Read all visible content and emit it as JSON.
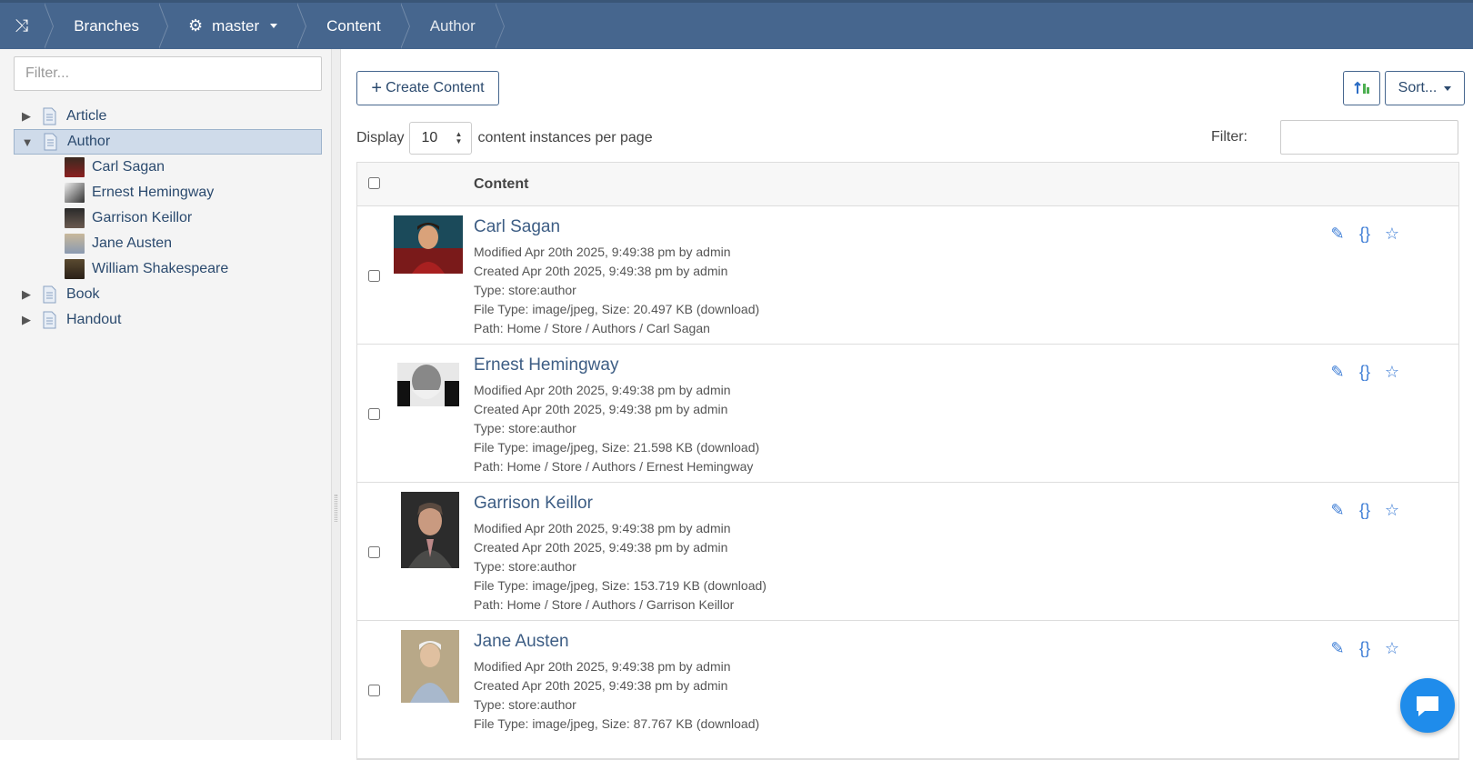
{
  "breadcrumb": {
    "items": [
      {
        "label": "Branches"
      },
      {
        "label": "master"
      },
      {
        "label": "Content"
      },
      {
        "label": "Author"
      }
    ]
  },
  "sidebar": {
    "filter_placeholder": "Filter...",
    "tree": [
      {
        "label": "Article",
        "expanded": false
      },
      {
        "label": "Author",
        "expanded": true,
        "selected": true,
        "children": [
          "Carl Sagan",
          "Ernest Hemingway",
          "Garrison Keillor",
          "Jane Austen",
          "William Shakespeare"
        ]
      },
      {
        "label": "Book",
        "expanded": false
      },
      {
        "label": "Handout",
        "expanded": false
      }
    ]
  },
  "toolbar": {
    "create_label": "Create Content",
    "sort_label": "Sort..."
  },
  "display": {
    "prefix": "Display",
    "per_page": "10",
    "suffix": "content instances per page",
    "filter_label": "Filter:"
  },
  "table": {
    "header": "Content",
    "rows": [
      {
        "title": "Carl Sagan",
        "modified": "Modified Apr 20th 2025, 9:49:38 pm by admin",
        "created": "Created Apr 20th 2025, 9:49:38 pm by admin",
        "type": "Type: store:author",
        "file": "File Type: image/jpeg, Size: 20.497 KB (download)",
        "path": "Path: Home / Store / Authors / Carl Sagan"
      },
      {
        "title": "Ernest Hemingway",
        "modified": "Modified Apr 20th 2025, 9:49:38 pm by admin",
        "created": "Created Apr 20th 2025, 9:49:38 pm by admin",
        "type": "Type: store:author",
        "file": "File Type: image/jpeg, Size: 21.598 KB (download)",
        "path": "Path: Home / Store / Authors / Ernest Hemingway"
      },
      {
        "title": "Garrison Keillor",
        "modified": "Modified Apr 20th 2025, 9:49:38 pm by admin",
        "created": "Created Apr 20th 2025, 9:49:38 pm by admin",
        "type": "Type: store:author",
        "file": "File Type: image/jpeg, Size: 153.719 KB (download)",
        "path": "Path: Home / Store / Authors / Garrison Keillor"
      },
      {
        "title": "Jane Austen",
        "modified": "Modified Apr 20th 2025, 9:49:38 pm by admin",
        "created": "Created Apr 20th 2025, 9:49:38 pm by admin",
        "type": "Type: store:author",
        "file": "File Type: image/jpeg, Size: 87.767 KB (download)",
        "path": ""
      }
    ]
  },
  "colors": {
    "topbar": "#46668e",
    "accent": "#3a7bd5",
    "selected_row": "#cfdbea"
  }
}
